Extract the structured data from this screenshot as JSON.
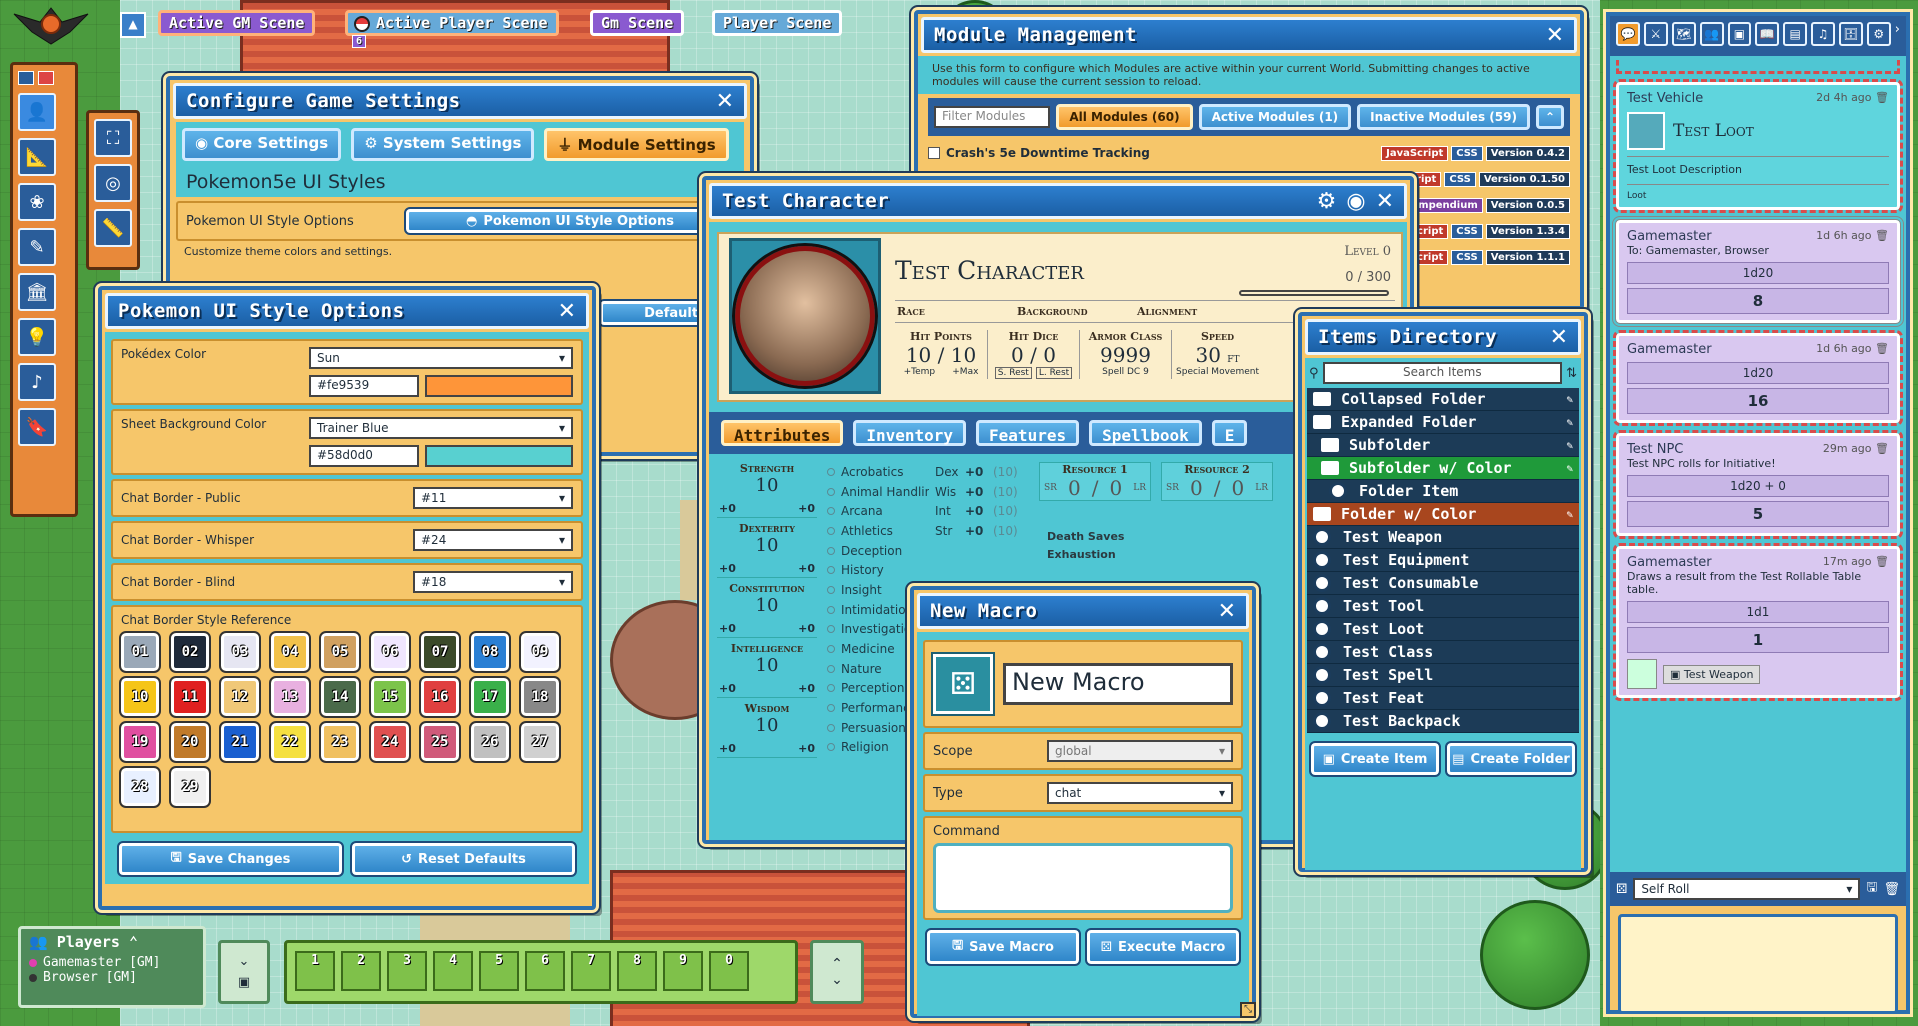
{
  "scene_nav": {
    "active_gm": "Active GM Scene",
    "active_player": "Active Player Scene",
    "player_count": "6",
    "gm_scene": "Gm Scene",
    "player_scene": "Player Scene"
  },
  "module_mgmt": {
    "title": "Module Management",
    "description": "Use this form to configure which Modules are active within your current World. Submitting changes to active modules will cause the current session to reload.",
    "filter_placeholder": "Filter Modules",
    "tab_all": "All Modules (60)",
    "tab_active": "Active Modules (1)",
    "tab_inactive": "Inactive Modules (59)",
    "first_module": "Crash's 5e Downtime Tracking",
    "js": "JavaScript",
    "css": "CSS",
    "compendium": "Compendium",
    "versions": [
      "Version 0.4.2",
      "Version 0.1.50",
      "Version 0.0.5",
      "Version 1.3.4",
      "Version 1.1.1"
    ]
  },
  "game_settings": {
    "title": "Configure Game Settings",
    "tab_core": "Core Settings",
    "tab_system": "System Settings",
    "tab_module": "Module Settings",
    "section_title": "Pokemon5e UI Styles",
    "option_label": "Pokemon UI Style Options",
    "option_button": "Pokemon UI Style Options",
    "option_hint": "Customize theme colors and settings.",
    "partial_button": "Defaults"
  },
  "style_options": {
    "title": "Pokemon UI Style Options",
    "pokedex_label": "Pokédex Color",
    "pokedex_value": "Sun",
    "pokedex_hex": "#fe9539",
    "pokedex_color": "#fe9539",
    "sheet_label": "Sheet Background Color",
    "sheet_value": "Trainer Blue",
    "sheet_hex": "#58d0d0",
    "sheet_color": "#58d0d0",
    "public_label": "Chat Border - Public",
    "public_value": "#11",
    "whisper_label": "Chat Border - Whisper",
    "whisper_value": "#24",
    "blind_label": "Chat Border - Blind",
    "blind_value": "#18",
    "reference_label": "Chat Border Style Reference",
    "swatches": [
      "01",
      "02",
      "03",
      "04",
      "05",
      "06",
      "07",
      "08",
      "09",
      "10",
      "11",
      "12",
      "13",
      "14",
      "15",
      "16",
      "17",
      "18",
      "19",
      "20",
      "21",
      "22",
      "23",
      "24",
      "25",
      "26",
      "27",
      "28",
      "29"
    ],
    "save": "Save Changes",
    "reset": "Reset Defaults"
  },
  "character": {
    "window_title": "Test Character",
    "name": "Test Character",
    "level": "Level 0",
    "xp": "0 / 300",
    "race": "Race",
    "background": "Background",
    "alignment": "Alignment",
    "hp_label": "Hit Points",
    "hp": "10",
    "hp_max": "10",
    "temp": "+Temp",
    "max": "+Max",
    "hd_label": "Hit Dice",
    "hd": "0 / 0",
    "short_rest": "S. Rest",
    "long_rest": "L. Rest",
    "ac_label": "Armor Class",
    "ac": "9999",
    "spell_dc": "Spell DC 9",
    "speed_label": "Speed",
    "speed": "30",
    "speed_unit": "ft",
    "special": "Special Movement",
    "tabs": [
      "Attributes",
      "Inventory",
      "Features",
      "Spellbook",
      "E"
    ],
    "abilities": [
      {
        "name": "Strength",
        "score": "10",
        "mod": "+0",
        "save": "+0"
      },
      {
        "name": "Dexterity",
        "score": "10",
        "mod": "+0",
        "save": "+0"
      },
      {
        "name": "Constitution",
        "score": "10",
        "mod": "+0",
        "save": "+0"
      },
      {
        "name": "Intelligence",
        "score": "10",
        "mod": "+0",
        "save": "+0"
      },
      {
        "name": "Wisdom",
        "score": "10",
        "mod": "+0",
        "save": "+0"
      }
    ],
    "skills": [
      {
        "name": "Acrobatics",
        "ab": "Dex",
        "mod": "+0",
        "pass": "(10)"
      },
      {
        "name": "Animal Handling",
        "ab": "Wis",
        "mod": "+0",
        "pass": "(10)"
      },
      {
        "name": "Arcana",
        "ab": "Int",
        "mod": "+0",
        "pass": "(10)"
      },
      {
        "name": "Athletics",
        "ab": "Str",
        "mod": "+0",
        "pass": "(10)"
      },
      {
        "name": "Deception",
        "ab": "",
        "mod": "",
        "pass": ""
      },
      {
        "name": "History",
        "ab": "",
        "mod": "",
        "pass": ""
      },
      {
        "name": "Insight",
        "ab": "",
        "mod": "",
        "pass": ""
      },
      {
        "name": "Intimidation",
        "ab": "",
        "mod": "",
        "pass": ""
      },
      {
        "name": "Investigation",
        "ab": "",
        "mod": "",
        "pass": ""
      },
      {
        "name": "Medicine",
        "ab": "",
        "mod": "",
        "pass": ""
      },
      {
        "name": "Nature",
        "ab": "",
        "mod": "",
        "pass": ""
      },
      {
        "name": "Perception",
        "ab": "",
        "mod": "",
        "pass": ""
      },
      {
        "name": "Performance",
        "ab": "",
        "mod": "",
        "pass": ""
      },
      {
        "name": "Persuasion",
        "ab": "",
        "mod": "",
        "pass": ""
      },
      {
        "name": "Religion",
        "ab": "",
        "mod": "",
        "pass": ""
      }
    ],
    "res1": "Resource 1",
    "res2": "Resource 2",
    "sr": "SR",
    "lr": "LR",
    "res_val": "0",
    "death_saves": "Death Saves",
    "exhaustion": "Exhaustion"
  },
  "macro": {
    "title": "New Macro",
    "name": "New Macro",
    "scope_label": "Scope",
    "scope": "global",
    "type_label": "Type",
    "type": "chat",
    "command_label": "Command",
    "save": "Save Macro",
    "execute": "Execute Macro"
  },
  "items_dir": {
    "title": "Items Directory",
    "search_placeholder": "Search Items",
    "folders": [
      {
        "label": "Collapsed Folder",
        "color": "#1c3b57",
        "indent": 0
      },
      {
        "label": "Expanded Folder",
        "color": "#1c3b57",
        "indent": 0
      },
      {
        "label": "Subfolder",
        "color": "#1c3b57",
        "indent": 1
      },
      {
        "label": "Subfolder w/ Color",
        "color": "#1f9a3a",
        "indent": 1
      }
    ],
    "folder_item": "Folder Item",
    "color_folder": "Folder w/ Color",
    "items": [
      "Test Weapon",
      "Test Equipment",
      "Test Consumable",
      "Test Tool",
      "Test Loot",
      "Test Class",
      "Test Spell",
      "Test Feat",
      "Test Backpack"
    ],
    "create_item": "Create Item",
    "create_folder": "Create Folder"
  },
  "chat": {
    "card": {
      "title": "Test Vehicle",
      "time": "2d 4h ago",
      "item": "Test Loot",
      "desc": "Test Loot Description",
      "footer": "Loot"
    },
    "messages": [
      {
        "who": "Gamemaster",
        "time": "1d 6h ago",
        "to": "To: Gamemaster, Browser",
        "formula": "1d20",
        "result": "8"
      },
      {
        "who": "Gamemaster",
        "time": "1d 6h ago",
        "formula": "1d20",
        "result": "16"
      },
      {
        "who": "Test NPC",
        "time": "29m ago",
        "text": "Test NPC rolls for Initiative!",
        "formula": "1d20 + 0",
        "result": "5"
      },
      {
        "who": "Gamemaster",
        "time": "17m ago",
        "text": "Draws a result from the Test Rollable Table table.",
        "formula": "1d1",
        "result": "1",
        "item": "Test Weapon"
      }
    ],
    "roll_mode": "Self Roll"
  },
  "players": {
    "title": "Players",
    "list": [
      {
        "name": "Gamemaster [GM]",
        "color": "#e03fb0"
      },
      {
        "name": "Browser [GM]",
        "color": "#333333"
      }
    ]
  },
  "hotbar": [
    "1",
    "2",
    "3",
    "4",
    "5",
    "6",
    "7",
    "8",
    "9",
    "0"
  ]
}
